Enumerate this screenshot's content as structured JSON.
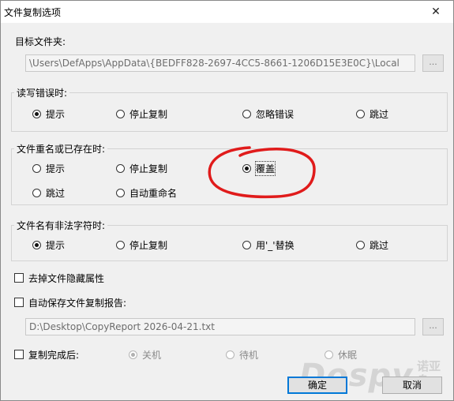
{
  "window": {
    "title": "文件复制选项",
    "close": "✕"
  },
  "target_folder": {
    "label": "目标文件夹:",
    "value": "\\Users\\DefApps\\AppData\\{BEDFF828-2697-4CC5-8661-1206D15E3E0C}\\Local",
    "browse": "..."
  },
  "rw_error": {
    "title": "读写错误时:",
    "options": [
      {
        "label": "提示",
        "checked": true
      },
      {
        "label": "停止复制",
        "checked": false
      },
      {
        "label": "忽略错误",
        "checked": false
      },
      {
        "label": "跳过",
        "checked": false
      }
    ]
  },
  "rename_exists": {
    "title": "文件重名或已存在时:",
    "options": [
      {
        "label": "提示",
        "checked": false
      },
      {
        "label": "停止复制",
        "checked": false
      },
      {
        "label": "覆盖",
        "checked": true
      },
      {
        "label": "跳过",
        "checked": false
      },
      {
        "label": "自动重命名",
        "checked": false
      }
    ],
    "annotation_color": "#e01b1b"
  },
  "illegal_chars": {
    "title": "文件名有非法字符时:",
    "options": [
      {
        "label": "提示",
        "checked": true
      },
      {
        "label": "停止复制",
        "checked": false
      },
      {
        "label": "用'_'替换",
        "checked": false
      },
      {
        "label": "跳过",
        "checked": false
      }
    ]
  },
  "remove_hidden": {
    "label": "去掉文件隐藏属性",
    "checked": false
  },
  "auto_save_report": {
    "label": "自动保存文件复制报告:",
    "checked": false,
    "path": "D:\\Desktop\\CopyReport 2026-04-21.txt",
    "browse": "..."
  },
  "after_copy": {
    "label": "复制完成后:",
    "checked": false,
    "options": [
      {
        "label": "关机",
        "checked": true
      },
      {
        "label": "待机",
        "checked": false
      },
      {
        "label": "休眠",
        "checked": false
      }
    ]
  },
  "buttons": {
    "ok": "确定",
    "cancel": "取消"
  },
  "watermark": {
    "text": "Dospy",
    "cn": "诺亚舟"
  }
}
